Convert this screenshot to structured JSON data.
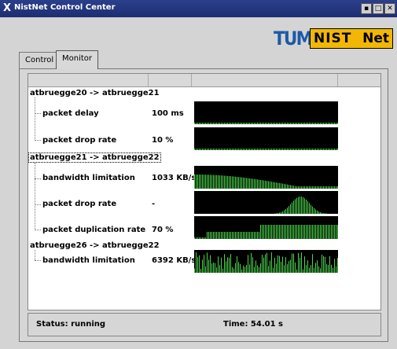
{
  "window": {
    "title": "NistNet Control Center",
    "min_glyph": "▪",
    "max_glyph": "□",
    "close_glyph": "✕"
  },
  "logos": {
    "tum": "TUM",
    "nist_left": "NIST",
    "nist_right": "Net"
  },
  "tabs": [
    {
      "label": "Control",
      "active": false
    },
    {
      "label": "Monitor",
      "active": true
    }
  ],
  "groups": [
    {
      "label": "atbruegge20 -> atbruegge21",
      "selected": false,
      "rows": [
        {
          "label": "packet delay",
          "value": "100 ms",
          "graph": "baseline"
        },
        {
          "label": "packet drop rate",
          "value": "10 %",
          "graph": "baseline"
        }
      ]
    },
    {
      "label": "atbruegge21 -> atbruegge22",
      "selected": true,
      "rows": [
        {
          "label": "bandwidth limitation",
          "value": "1033 KB/s",
          "graph": "decay"
        },
        {
          "label": "packet drop rate",
          "value": "-",
          "graph": "bump"
        },
        {
          "label": "packet duplication rate",
          "value": "70 %",
          "graph": "steps"
        }
      ]
    },
    {
      "label": "atbruegge26 -> atbruegge22",
      "selected": false,
      "rows": [
        {
          "label": "bandwidth limitation",
          "value": "6392 KB/s",
          "graph": "noise"
        }
      ]
    }
  ],
  "status": {
    "text": "Status: running",
    "time": "Time: 54.01 s"
  },
  "colors": {
    "graph_bg": "#000000",
    "graph_fg": "#4cd64c"
  }
}
